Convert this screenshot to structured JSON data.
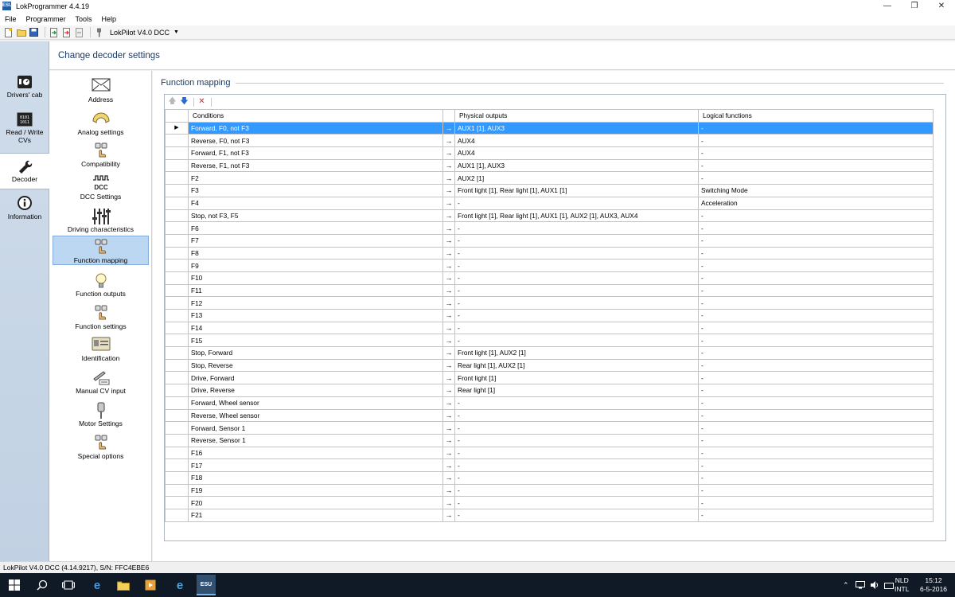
{
  "window": {
    "title": "LokProgrammer 4.4.19",
    "app_icon_text": "ESU"
  },
  "menu": [
    "File",
    "Programmer",
    "Tools",
    "Help"
  ],
  "toolbar": {
    "decoder_type": "LokPilot V4.0 DCC"
  },
  "left_nav": [
    {
      "label": "Drivers' cab",
      "icon": "drivers-cab-icon"
    },
    {
      "label": "Read / Write CVs",
      "icon": "binary-icon"
    },
    {
      "label": "Decoder",
      "icon": "wrench-icon",
      "active": true
    },
    {
      "label": "Information",
      "icon": "info-icon"
    }
  ],
  "header": {
    "title": "Change decoder settings"
  },
  "settings_list": [
    {
      "label": "Address",
      "icon": "envelope-icon"
    },
    {
      "label": "Analog settings",
      "icon": "gauge-icon"
    },
    {
      "label": "Compatibility",
      "icon": "hand-buttons-icon"
    },
    {
      "label": "DCC Settings",
      "icon": "dcc-icon",
      "icon_text": "DCC"
    },
    {
      "label": "Driving characteristics",
      "icon": "sliders-icon"
    },
    {
      "label": "Function mapping",
      "icon": "hand-buttons-icon",
      "active": true
    },
    {
      "label": "Function outputs",
      "icon": "bulb-icon"
    },
    {
      "label": "Function settings",
      "icon": "hand-buttons-icon"
    },
    {
      "label": "Identification",
      "icon": "id-card-icon"
    },
    {
      "label": "Manual CV input",
      "icon": "keyboard-icon"
    },
    {
      "label": "Motor Settings",
      "icon": "motor-icon"
    },
    {
      "label": "Special options",
      "icon": "hand-buttons-icon"
    }
  ],
  "section": {
    "title": "Function mapping"
  },
  "grid": {
    "columns": [
      "Conditions",
      "Physical outputs",
      "Logical functions"
    ],
    "selected_row": 0,
    "arrow_glyph": "→",
    "rows": [
      [
        "Forward, F0, not F3",
        "AUX1 [1], AUX3",
        "-"
      ],
      [
        "Reverse, F0, not F3",
        "AUX4",
        "-"
      ],
      [
        "Forward, F1, not F3",
        "AUX4",
        "-"
      ],
      [
        "Reverse, F1, not F3",
        "AUX1 [1], AUX3",
        "-"
      ],
      [
        "F2",
        "AUX2 [1]",
        "-"
      ],
      [
        "F3",
        "Front light [1], Rear light [1], AUX1 [1]",
        "Switching Mode"
      ],
      [
        "F4",
        "-",
        "Acceleration"
      ],
      [
        "Stop, not F3, F5",
        "Front light [1], Rear light [1], AUX1 [1], AUX2 [1], AUX3, AUX4",
        "-"
      ],
      [
        "F6",
        "-",
        "-"
      ],
      [
        "F7",
        "-",
        "-"
      ],
      [
        "F8",
        "-",
        "-"
      ],
      [
        "F9",
        "-",
        "-"
      ],
      [
        "F10",
        "-",
        "-"
      ],
      [
        "F11",
        "-",
        "-"
      ],
      [
        "F12",
        "-",
        "-"
      ],
      [
        "F13",
        "-",
        "-"
      ],
      [
        "F14",
        "-",
        "-"
      ],
      [
        "F15",
        "-",
        "-"
      ],
      [
        "Stop, Forward",
        "Front light [1], AUX2 [1]",
        "-"
      ],
      [
        "Stop, Reverse",
        "Rear light [1], AUX2 [1]",
        "-"
      ],
      [
        "Drive, Forward",
        "Front light [1]",
        "-"
      ],
      [
        "Drive, Reverse",
        "Rear light [1]",
        "-"
      ],
      [
        "Forward, Wheel sensor",
        "-",
        "-"
      ],
      [
        "Reverse, Wheel sensor",
        "-",
        "-"
      ],
      [
        "Forward, Sensor 1",
        "-",
        "-"
      ],
      [
        "Reverse, Sensor 1",
        "-",
        "-"
      ],
      [
        "F16",
        "-",
        "-"
      ],
      [
        "F17",
        "-",
        "-"
      ],
      [
        "F18",
        "-",
        "-"
      ],
      [
        "F19",
        "-",
        "-"
      ],
      [
        "F20",
        "-",
        "-"
      ],
      [
        "F21",
        "-",
        "-"
      ]
    ]
  },
  "status": {
    "text": "LokPilot V4.0 DCC (4.14.9217), S/N: FFC4EBE6"
  },
  "taskbar": {
    "language": [
      "NLD",
      "INTL"
    ],
    "time": "15:12",
    "date": "6-5-2016",
    "esu_label": "ESU"
  },
  "colors": {
    "selection": "#3399ff",
    "nav_bg": "#c8d7e8",
    "title_blue": "#1b3a66",
    "taskbar": "#101a26"
  }
}
